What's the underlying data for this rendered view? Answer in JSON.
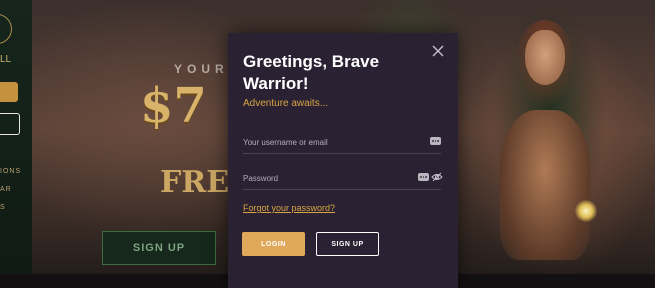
{
  "background": {
    "left_logo_text": "LL",
    "left_menu": [
      "IONS",
      "AR",
      "S"
    ],
    "promo_small": "YOUR W",
    "promo_big": "$7",
    "promo_free": "FREE",
    "signup_label": "SIGN UP"
  },
  "modal": {
    "title": "Greetings, Brave Warrior!",
    "subtitle": "Adventure awaits...",
    "username": {
      "placeholder": "Your username or email",
      "value": ""
    },
    "password": {
      "placeholder": "Password",
      "value": ""
    },
    "forgot_link": "Forgot your password?",
    "login_label": "LOGIN",
    "signup_label": "SIGN UP"
  },
  "icons": {
    "close": "close-icon",
    "autofill": "more-dots-icon",
    "toggle_password": "eye-off-icon"
  },
  "colors": {
    "accent_gold": "#d9a443",
    "login_button": "#e0a85a",
    "modal_bg": "#2a2233"
  }
}
